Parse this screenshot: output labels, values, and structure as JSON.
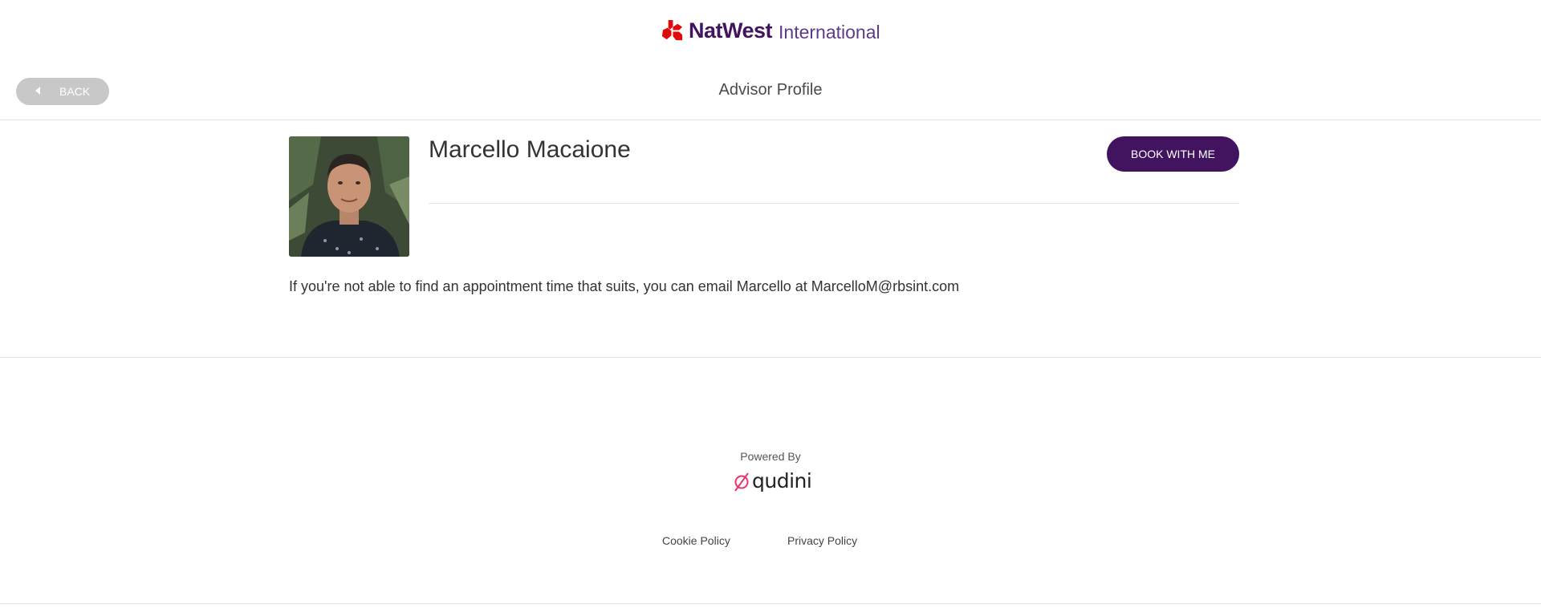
{
  "header": {
    "brand": "NatWest",
    "brand_sub": "International",
    "back_label": "BACK",
    "page_title": "Advisor Profile"
  },
  "profile": {
    "name": "Marcello Macaione",
    "book_label": "BOOK WITH ME",
    "contact_text": "If you're not able to find an appointment time that suits, you can email Marcello at MarcelloM@rbsint.com"
  },
  "footer": {
    "powered_by": "Powered By",
    "qudini_wordmark": "qudini",
    "links": [
      "Cookie Policy",
      "Privacy Policy"
    ]
  },
  "colors": {
    "brand_purple": "#42145f",
    "natwest_red": "#e10a0a",
    "back_button_grey": "#c8c8c8",
    "qudini_pink": "#e8356b"
  },
  "icons": {
    "back": "caret-left-icon",
    "logo": "natwest-chevrons-logo",
    "qudini": "qudini-logo"
  }
}
